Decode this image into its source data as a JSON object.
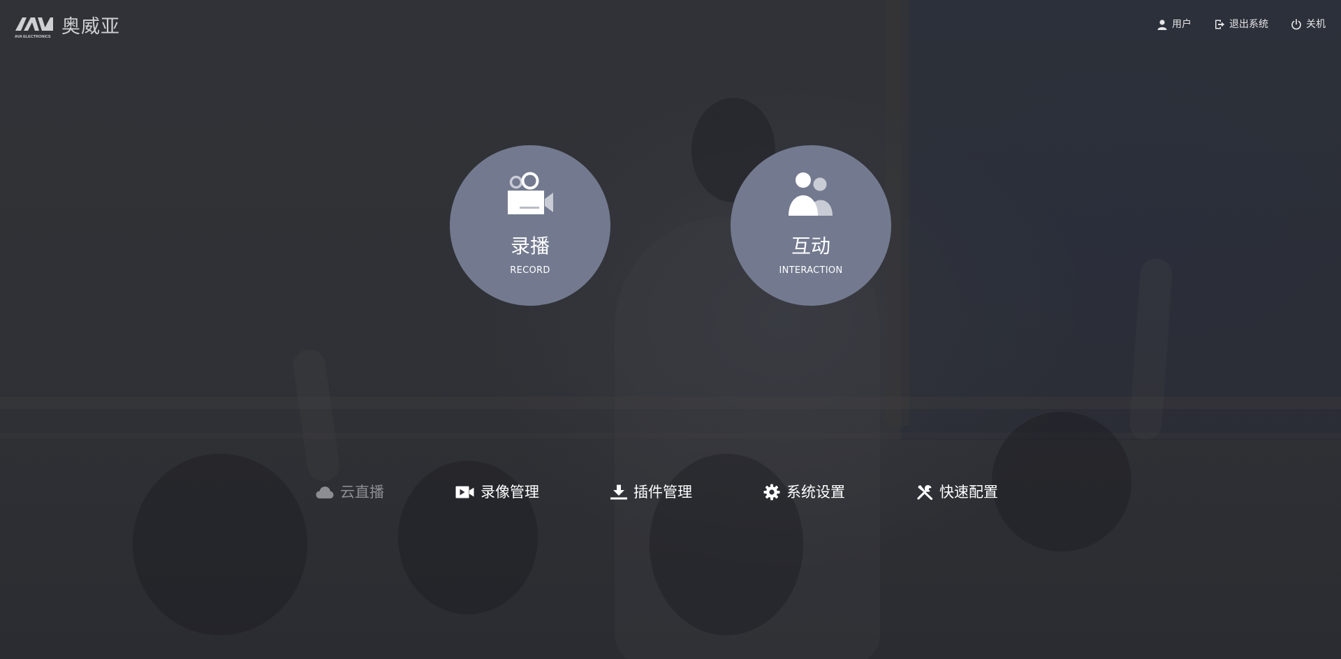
{
  "logo": {
    "mark_text": "AVA ELECTRONICS",
    "brand_name": "奥威亚"
  },
  "top_actions": [
    {
      "label": "用户",
      "icon": "user-icon"
    },
    {
      "label": "退出系统",
      "icon": "logout-icon"
    },
    {
      "label": "关机",
      "icon": "power-icon"
    }
  ],
  "modes": [
    {
      "title": "录播",
      "subtitle": "RECORD",
      "icon": "video-camera-icon"
    },
    {
      "title": "互动",
      "subtitle": "INTERACTION",
      "icon": "users-icon"
    }
  ],
  "bottom_nav": [
    {
      "label": "云直播",
      "icon": "cloud-icon",
      "state": "disabled"
    },
    {
      "label": "录像管理",
      "icon": "video-icon",
      "state": "enabled"
    },
    {
      "label": "插件管理",
      "icon": "download-icon",
      "state": "enabled"
    },
    {
      "label": "系统设置",
      "icon": "gear-icon",
      "state": "enabled"
    },
    {
      "label": "快速配置",
      "icon": "wrench-icon",
      "state": "enabled"
    }
  ],
  "colors": {
    "background": "#2e3036",
    "circle": "#737a8f",
    "text": "#ffffff",
    "disabled_text": "#8c8d92"
  }
}
